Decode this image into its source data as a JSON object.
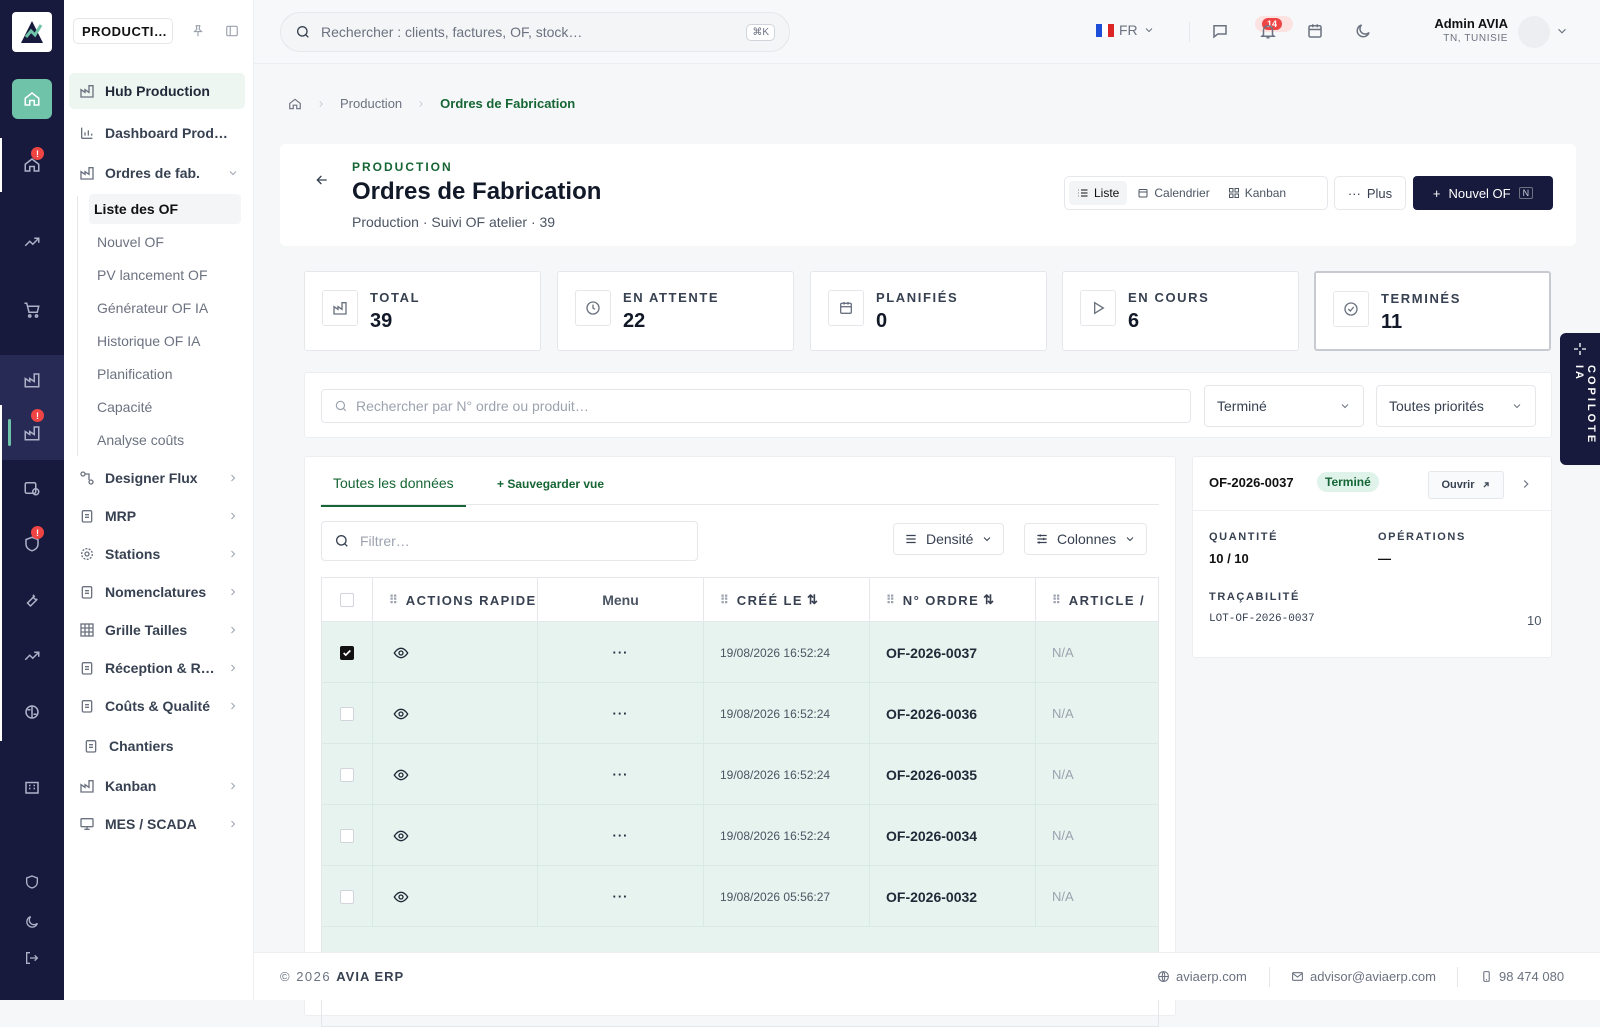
{
  "app": {
    "module": "PRODUCTI…",
    "user_name": "Admin AVIA",
    "user_region": "TN, TUNISIE",
    "lang": "FR"
  },
  "topbar": {
    "search_placeholder": "Rechercher : clients, factures, OF, stock…",
    "shortcut": "⌘K",
    "notifications": "14"
  },
  "rail": {
    "badges": [
      "!",
      "!",
      "!"
    ]
  },
  "sidebar": {
    "hub": "Hub Production",
    "dashboard": "Dashboard Prod…",
    "of": "Ordres de fab.",
    "sub": [
      "Liste des OF",
      "Nouvel OF",
      "PV lancement OF",
      "Générateur OF IA",
      "Historique OF IA",
      "Planification",
      "Capacité",
      "Analyse coûts"
    ],
    "items": [
      "Designer Flux",
      "MRP",
      "Stations",
      "Nomenclatures",
      "Grille Tailles",
      "Réception & R…",
      "Coûts & Qualité",
      "Chantiers",
      "Kanban",
      "MES / SCADA"
    ]
  },
  "breadcrumb": {
    "section": "Production",
    "current": "Ordres de Fabrication"
  },
  "header": {
    "eyebrow": "PRODUCTION",
    "title": "Ordres de Fabrication",
    "subtitle": "Production · Suivi OF atelier · 39",
    "views": [
      "Liste",
      "Calendrier",
      "Kanban"
    ],
    "more": "Plus",
    "new": "Nouvel OF",
    "new_key": "N"
  },
  "kpis": [
    {
      "label": "TOTAL",
      "value": "39"
    },
    {
      "label": "EN ATTENTE",
      "value": "22"
    },
    {
      "label": "PLANIFIÉS",
      "value": "0"
    },
    {
      "label": "EN COURS",
      "value": "6"
    },
    {
      "label": "TERMINÉS",
      "value": "11"
    }
  ],
  "filters": {
    "search_placeholder": "Rechercher par N° ordre ou produit…",
    "status": "Terminé",
    "priority": "Toutes priorités"
  },
  "table": {
    "tab": "Toutes les données",
    "save_view": "+ Sauvegarder vue",
    "filter_placeholder": "Filtrer…",
    "density": "Densité",
    "columns_btn": "Colonnes",
    "headers": [
      "ACTIONS RAPIDES",
      "Menu",
      "CRÉÉ LE",
      "N° ORDRE",
      "ARTICLE /"
    ],
    "rows": [
      {
        "checked": true,
        "created": "19/08/2026 16:52:24",
        "order": "OF-2026-0037",
        "article": "N/A"
      },
      {
        "checked": false,
        "created": "19/08/2026 16:52:24",
        "order": "OF-2026-0036",
        "article": "N/A"
      },
      {
        "checked": false,
        "created": "19/08/2026 16:52:24",
        "order": "OF-2026-0035",
        "article": "N/A"
      },
      {
        "checked": false,
        "created": "19/08/2026 16:52:24",
        "order": "OF-2026-0034",
        "article": "N/A"
      },
      {
        "checked": false,
        "created": "19/08/2026 05:56:27",
        "order": "OF-2026-0032",
        "article": "N/A"
      }
    ]
  },
  "detail": {
    "id": "OF-2026-0037",
    "status": "Terminé",
    "open": "Ouvrir",
    "qty_label": "QUANTITÉ",
    "qty": "10 / 10",
    "ops_label": "OPÉRATIONS",
    "ops": "—",
    "trace_label": "TRAÇABILITÉ",
    "lot": "LOT-OF-2026-0037",
    "lot_qty": "10"
  },
  "copilot": "COPILOTE IA",
  "footer": {
    "year": "© 2026",
    "brand": "AVIA ERP",
    "site": "aviaerp.com",
    "email": "advisor@aviaerp.com",
    "phone": "98 474 080"
  },
  "colors": {
    "navy": "#171a3d",
    "accent": "#6fc3a8",
    "green": "#166534",
    "row": "#e6f3ef"
  }
}
